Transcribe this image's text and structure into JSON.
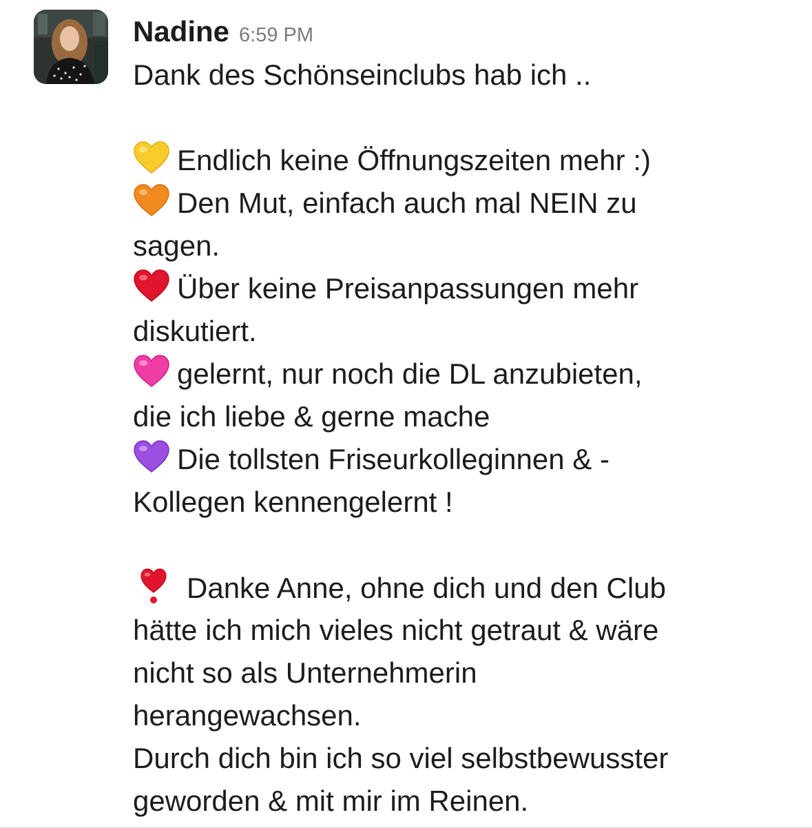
{
  "message": {
    "sender": "Nadine",
    "timestamp": "6:59 PM",
    "avatar_icon": "user-avatar-photo",
    "lines": {
      "intro": "Dank des Schönseinclubs hab ich ..",
      "point1": "Endlich keine Öffnungszeiten mehr :)",
      "point2a": "Den Mut, einfach auch mal NEIN zu",
      "point2b": "sagen.",
      "point3a": "Über keine Preisanpassungen mehr",
      "point3b": "diskutiert.",
      "point4a": "gelernt, nur noch die DL anzubieten,",
      "point4b": "die ich liebe & gerne mache",
      "point5a": "Die tollsten Friseurkolleginnen & -",
      "point5b": "Kollegen kennengelernt !",
      "thanks1": "Danke Anne, ohne dich und den Club",
      "thanks2": "hätte ich mich vieles nicht getraut & wäre",
      "thanks3": "nicht so als Unternehmerin",
      "thanks4": "herangewachsen.",
      "closing1": "Durch dich bin ich so viel selbstbewusster",
      "closing2": "geworden & mit mir im Reinen."
    },
    "emoji": {
      "point1": "yellow-heart-icon",
      "point2": "orange-heart-icon",
      "point3": "red-heart-icon",
      "point4": "pink-heart-icon",
      "point5": "purple-heart-icon",
      "thanks": "heart-exclamation-icon"
    }
  },
  "colors": {
    "yellow_heart": "#f8cd2b",
    "orange_heart": "#f28b1f",
    "red_heart": "#e0142d",
    "pink_heart": "#ee3ea6",
    "purple_heart": "#9b4ee0",
    "timestamp_gray": "#7b7b7c",
    "text": "#1d1c1d"
  }
}
